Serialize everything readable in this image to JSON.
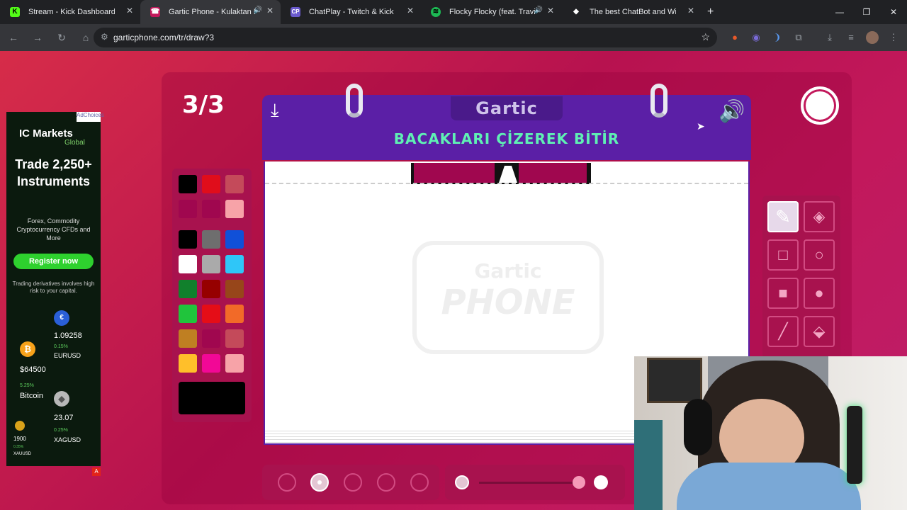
{
  "browser": {
    "tabs": [
      {
        "label": "Stream - Kick Dashboard",
        "icon": "kick-icon",
        "color": "#53fc18"
      },
      {
        "label": "Gartic Phone - Kulaktan Kul",
        "icon": "gartic-icon",
        "color": "#c2185b"
      },
      {
        "label": "ChatPlay - Twitch & Kick İzleyic",
        "icon": "chatplay-icon",
        "color": "#6a5acd"
      },
      {
        "label": "Flocky Flocky (feat. Travis Sc",
        "icon": "spotify-icon",
        "color": "#1db954"
      },
      {
        "label": "The best ChatBot and Widgets",
        "icon": "bot-icon",
        "color": "#ffffff"
      }
    ],
    "url": "garticphone.com/tr/draw?3"
  },
  "game": {
    "round": "3/3",
    "logo": "Gartic",
    "task": "BACAKLARI ÇİZEREK BİTİR",
    "watermark_top": "Gartic",
    "watermark_bottom": "PHONE"
  },
  "palette": {
    "colors": [
      [
        "#000000",
        "#e00d1b",
        "#c44a5a"
      ],
      [
        "#a0074f",
        "#a0074f",
        "#f7a3a8"
      ],
      [
        "#000000",
        "#6e6e6e",
        "#1050d8"
      ],
      [
        "#ffffff",
        "#aaaaaa",
        "#2fc6f8"
      ],
      [
        "#11802c",
        "#960000",
        "#97461a"
      ],
      [
        "#20c43c",
        "#e50d17",
        "#f26a28"
      ],
      [
        "#bf7f22",
        "#a0074f",
        "#c44a5a"
      ],
      [
        "#ffbf2a",
        "#f20896",
        "#f7a3a8"
      ]
    ],
    "selected": "#000000"
  },
  "tools": [
    "pen-tool",
    "eraser-tool",
    "rectangle-outline-tool",
    "ellipse-outline-tool",
    "rectangle-fill-tool",
    "ellipse-fill-tool",
    "line-tool",
    "fill-bucket-tool"
  ],
  "ad": {
    "brand": "IC Markets",
    "brand_sub": "Global",
    "headline": "Trade 2,250+ Instruments",
    "subtext": "Forex, Commodity Cryptocurrency CFDs and More",
    "cta": "Register now",
    "risk": "Trading derivatives involves high risk to your capital.",
    "adchoices": "AdChoices",
    "tickers": [
      {
        "name": "EURUSD",
        "value": "1.09258",
        "change": "0.15%"
      },
      {
        "name": "Bitcoin",
        "value": "$64500",
        "change": "5.25%"
      },
      {
        "name": "XAGUSD",
        "value": "23.07",
        "change": "0.25%"
      },
      {
        "name": "XAUUSD",
        "value": "1900",
        "change": "0.35%"
      }
    ]
  }
}
